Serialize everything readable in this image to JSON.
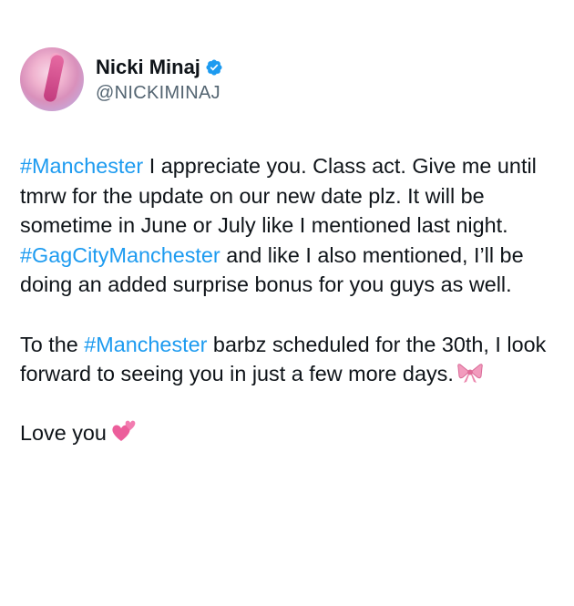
{
  "author": {
    "display_name": "Nicki Minaj",
    "handle": "@NICKIMINAJ",
    "avatar_icon": "profile-avatar",
    "verified_icon": "verified-badge-icon",
    "verified_color": "#1d9bf0"
  },
  "tweet": {
    "p1": {
      "hashtag1": "#Manchester",
      "t1": " I appreciate you. Class act. Give me until tmrw for the update on our new date plz. It will be sometime in June or July like I mentioned last night. ",
      "hashtag2": "#GagCityManchester",
      "t2": " and like I also mentioned, I’ll be doing an added surprise bonus for you guys as well."
    },
    "p2": {
      "t1": "To the ",
      "hashtag": "#Manchester",
      "t2": " barbz scheduled for the 30th, I look forward to seeing you in just a few more days.",
      "emoji_icon": "ribbon-bow-emoji"
    },
    "p3": {
      "text": "Love you",
      "emoji_icon": "two-hearts-emoji"
    }
  },
  "colors": {
    "hashtag": "#1d9bf0",
    "text": "#0f1419",
    "secondary": "#536471"
  }
}
